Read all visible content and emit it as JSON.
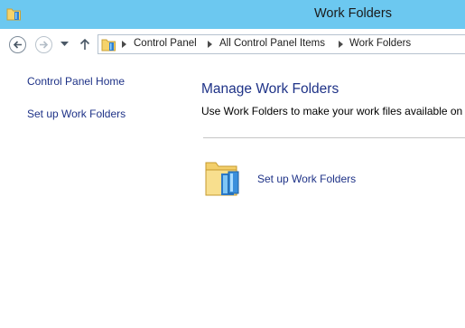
{
  "window": {
    "title": "Work Folders",
    "icon": "work-folders-icon"
  },
  "navigation": {
    "back_icon": "back-arrow-icon",
    "forward_icon": "forward-arrow-icon",
    "recent_icon": "chevron-down-icon",
    "up_icon": "up-arrow-icon",
    "breadcrumb": [
      "Control Panel",
      "All Control Panel Items",
      "Work Folders"
    ]
  },
  "sidebar": {
    "items": [
      {
        "label": "Control Panel Home"
      },
      {
        "label": "Set up Work Folders"
      }
    ]
  },
  "main": {
    "heading": "Manage Work Folders",
    "description": "Use Work Folders to make your work files available on a",
    "setup_link": "Set up Work Folders",
    "setup_icon": "work-folders-icon"
  },
  "colors": {
    "titlebar": "#6cc8f0",
    "link": "#1e3287",
    "divider": "#c6c6c6"
  }
}
